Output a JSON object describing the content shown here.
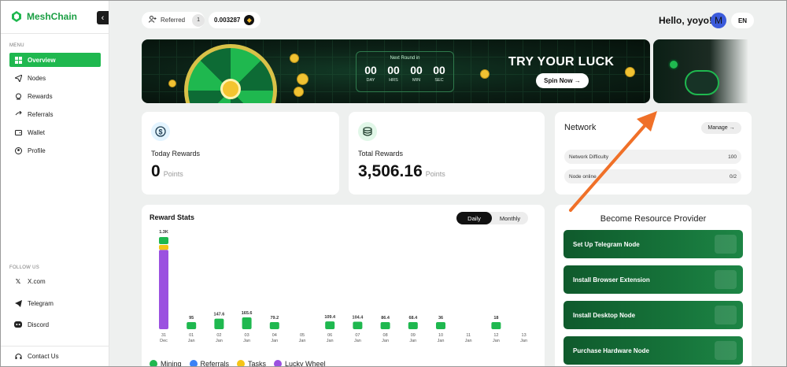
{
  "brand": {
    "name": "MeshChain"
  },
  "sidebar": {
    "menu_label": "MENU",
    "follow_label": "FOLLOW US",
    "items": [
      {
        "label": "Overview",
        "icon": "grid-icon"
      },
      {
        "label": "Nodes",
        "icon": "send-icon"
      },
      {
        "label": "Rewards",
        "icon": "rewards-icon"
      },
      {
        "label": "Referrals",
        "icon": "share-icon"
      },
      {
        "label": "Wallet",
        "icon": "wallet-icon"
      },
      {
        "label": "Profile",
        "icon": "profile-icon"
      }
    ],
    "social": [
      {
        "label": "X.com",
        "icon": "x-icon"
      },
      {
        "label": "Telegram",
        "icon": "telegram-icon"
      },
      {
        "label": "Discord",
        "icon": "discord-icon"
      }
    ],
    "contact": "Contact Us"
  },
  "topbar": {
    "referred_label": "Referred",
    "referred_count": "1",
    "balance": "0.003287",
    "greeting": "Hello, yoyo!",
    "avatar_letter": "M",
    "language": "EN"
  },
  "banner": {
    "next_round": "Next Round in",
    "countdown": [
      {
        "value": "00",
        "unit": "DAY"
      },
      {
        "value": "00",
        "unit": "HRS"
      },
      {
        "value": "00",
        "unit": "MIN"
      },
      {
        "value": "00",
        "unit": "SEC"
      }
    ],
    "headline": "TRY YOUR LUCK",
    "cta": "Spin Now →"
  },
  "stats": {
    "today": {
      "label": "Today Rewards",
      "value": "0",
      "unit": "Points",
      "icon": "dollar-icon"
    },
    "total": {
      "label": "Total Rewards",
      "value": "3,506.16",
      "unit": "Points",
      "icon": "coins-icon"
    }
  },
  "network": {
    "title": "Network",
    "manage": "Manage →",
    "rows": [
      {
        "label": "Network Difficulty",
        "value": "100"
      },
      {
        "label": "Node online",
        "value": "0/2"
      }
    ]
  },
  "reward_stats": {
    "title": "Reward Stats",
    "tabs": [
      "Daily",
      "Monthly"
    ],
    "active_tab": "Daily"
  },
  "chart_data": {
    "type": "bar",
    "title": "Reward Stats",
    "categories": [
      [
        "31",
        "Dec"
      ],
      [
        "01",
        "Jan"
      ],
      [
        "02",
        "Jan"
      ],
      [
        "03",
        "Jan"
      ],
      [
        "04",
        "Jan"
      ],
      [
        "05",
        "Jan"
      ],
      [
        "06",
        "Jan"
      ],
      [
        "07",
        "Jan"
      ],
      [
        "08",
        "Jan"
      ],
      [
        "09",
        "Jan"
      ],
      [
        "10",
        "Jan"
      ],
      [
        "11",
        "Jan"
      ],
      [
        "12",
        "Jan"
      ],
      [
        "13",
        "Jan"
      ]
    ],
    "value_labels": [
      "1.3K",
      "95",
      "147.6",
      "165.6",
      "79.2",
      "",
      "109.4",
      "104.4",
      "86.4",
      "68.4",
      "36",
      "",
      "18",
      ""
    ],
    "series": [
      {
        "name": "Mining",
        "color": "#1fb84f",
        "values": [
          110,
          95,
          147.6,
          165.6,
          79.2,
          0,
          109.4,
          104.4,
          86.4,
          68.4,
          36,
          0,
          18,
          0
        ]
      },
      {
        "name": "Referrals",
        "color": "#3b82f6",
        "values": [
          0,
          0,
          0,
          0,
          0,
          0,
          0,
          0,
          0,
          0,
          0,
          0,
          0,
          0
        ]
      },
      {
        "name": "Tasks",
        "color": "#f5c518",
        "values": [
          80,
          0,
          0,
          0,
          0,
          0,
          0,
          0,
          0,
          0,
          0,
          0,
          0,
          0
        ]
      },
      {
        "name": "Lucky Wheel",
        "color": "#9b51e0",
        "values": [
          1110,
          0,
          0,
          0,
          0,
          0,
          0,
          0,
          0,
          0,
          0,
          0,
          0,
          0
        ]
      }
    ]
  },
  "provider": {
    "title": "Become Resource Provider",
    "buttons": [
      "Set Up Telegram Node",
      "Install Browser Extension",
      "Install Desktop Node",
      "Purchase Hardware Node"
    ]
  },
  "colors": {
    "accent": "#1fb84f",
    "dark": "#0b1f15",
    "annotation_arrow": "#f07028"
  }
}
